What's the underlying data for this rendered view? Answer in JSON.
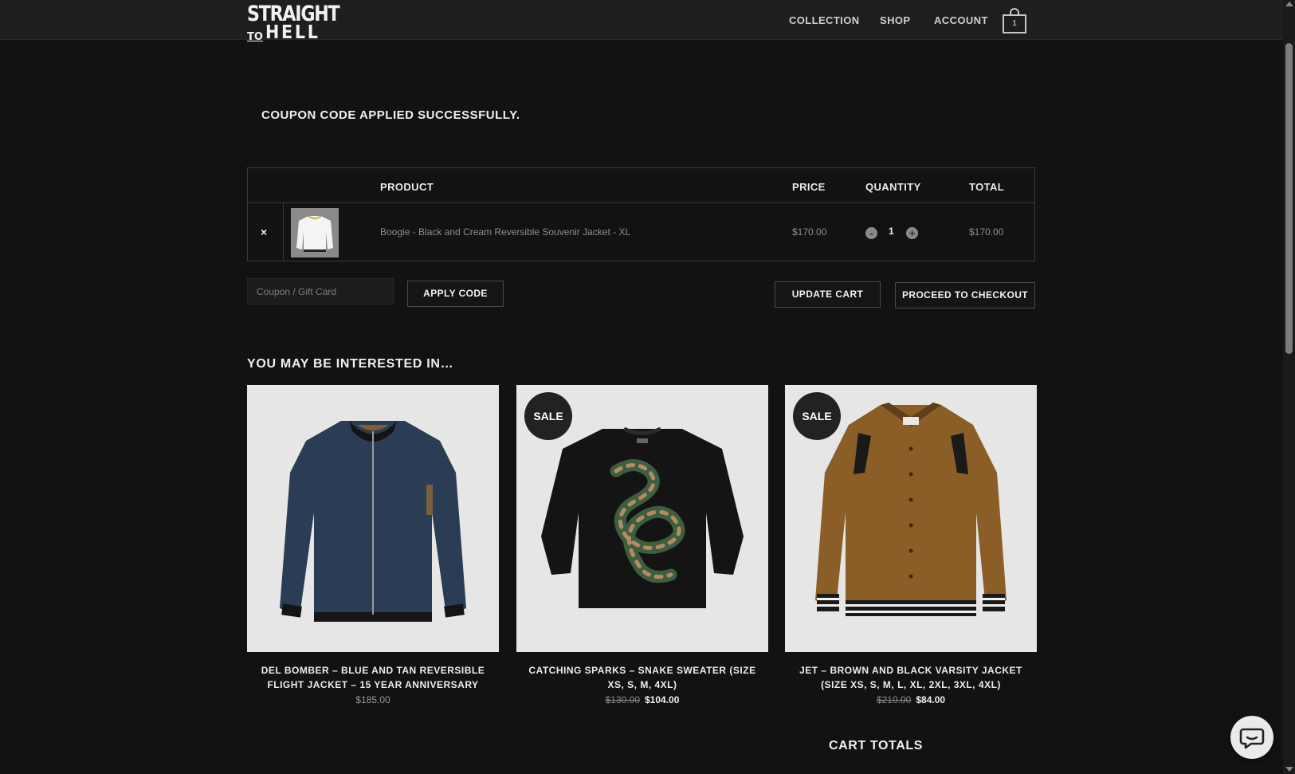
{
  "header": {
    "logo_line1": "STRAIGHT",
    "logo_to": "TO",
    "logo_line2": "HELL",
    "nav": [
      "COLLECTION",
      "SHOP",
      "ACCOUNT"
    ],
    "cart_count": "1"
  },
  "notice": "COUPON CODE APPLIED SUCCESSFULLY.",
  "cart": {
    "headers": {
      "product": "PRODUCT",
      "price": "PRICE",
      "quantity": "QUANTITY",
      "total": "TOTAL"
    },
    "items": [
      {
        "remove": "×",
        "name": "Boogie - Black and Cream Reversible Souvenir Jacket - XL",
        "price": "$170.00",
        "quantity": "1",
        "total": "$170.00"
      }
    ],
    "qty_minus": "-",
    "qty_plus": "+"
  },
  "actions": {
    "coupon_placeholder": "Coupon / Gift Card",
    "apply_label": "APPLY CODE",
    "update_label": "UPDATE CART",
    "checkout_label": "PROCEED TO CHECKOUT"
  },
  "recommend": {
    "title": "YOU MAY BE INTERESTED IN…",
    "sale_badge": "SALE",
    "products": [
      {
        "name": "DEL BOMBER – BLUE AND TAN REVERSIBLE FLIGHT JACKET – 15 YEAR ANNIVERSARY",
        "price": "$185.00",
        "old_price": "",
        "sale": false,
        "color": "#2a3d55"
      },
      {
        "name": "CATCHING SPARKS – SNAKE SWEATER (SIZE XS, S, M, 4XL)",
        "price": "$104.00",
        "old_price": "$130.00",
        "sale": true,
        "color": "#141414"
      },
      {
        "name": "JET – BROWN AND BLACK VARSITY JACKET (SIZE XS, S, M, L, XL, 2XL, 3XL, 4XL)",
        "price": "$84.00",
        "old_price": "$210.00",
        "sale": true,
        "color": "#8a5e26"
      }
    ]
  },
  "totals_title": "CART TOTALS"
}
